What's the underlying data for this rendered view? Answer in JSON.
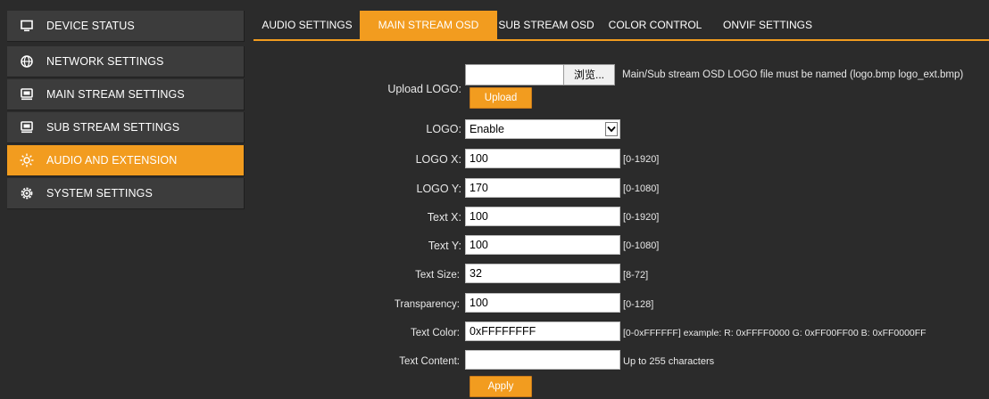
{
  "sidebar": {
    "items": [
      {
        "label": "DEVICE STATUS",
        "icon": "monitor-icon"
      },
      {
        "label": "NETWORK SETTINGS",
        "icon": "globe-icon"
      },
      {
        "label": "MAIN STREAM SETTINGS",
        "icon": "display-icon"
      },
      {
        "label": "SUB STREAM SETTINGS",
        "icon": "display-icon"
      },
      {
        "label": "AUDIO AND EXTENSION",
        "icon": "sun-icon",
        "active": true
      },
      {
        "label": "SYSTEM SETTINGS",
        "icon": "gear-icon"
      }
    ]
  },
  "tabs": [
    {
      "label": "AUDIO SETTINGS"
    },
    {
      "label": "MAIN STREAM OSD",
      "active": true
    },
    {
      "label": "SUB STREAM OSD"
    },
    {
      "label": "COLOR CONTROL"
    },
    {
      "label": "ONVIF SETTINGS"
    }
  ],
  "form": {
    "upload_logo_label": "Upload LOGO:",
    "browse_label": "浏览...",
    "upload_hint": "Main/Sub stream OSD LOGO file must be named (logo.bmp logo_ext.bmp)",
    "upload_button": "Upload",
    "logo_label": "LOGO:",
    "logo_value": "Enable",
    "logo_x_label": "LOGO X:",
    "logo_x_value": "100",
    "logo_x_hint": "[0-1920]",
    "logo_y_label": "LOGO Y:",
    "logo_y_value": "170",
    "logo_y_hint": "[0-1080]",
    "text_x_label": "Text X:",
    "text_x_value": "100",
    "text_x_hint": "[0-1920]",
    "text_y_label": "Text Y:",
    "text_y_value": "100",
    "text_y_hint": "[0-1080]",
    "text_size_label": "Text Size:",
    "text_size_value": "32",
    "text_size_hint": "[8-72]",
    "transparency_label": "Transparency:",
    "transparency_value": "100",
    "transparency_hint": "[0-128]",
    "text_color_label": "Text Color:",
    "text_color_value": "0xFFFFFFFF",
    "text_color_hint": "[0-0xFFFFFF] example: R: 0xFFFF0000 G: 0xFF00FF00 B: 0xFF0000FF",
    "text_content_label": "Text Content:",
    "text_content_value": "",
    "text_content_hint": "Up to 255 characters",
    "apply_button": "Apply"
  },
  "colors": {
    "accent": "#f29c1f",
    "background": "#2b2b2b",
    "sidebar_item": "#3c3c3c"
  }
}
